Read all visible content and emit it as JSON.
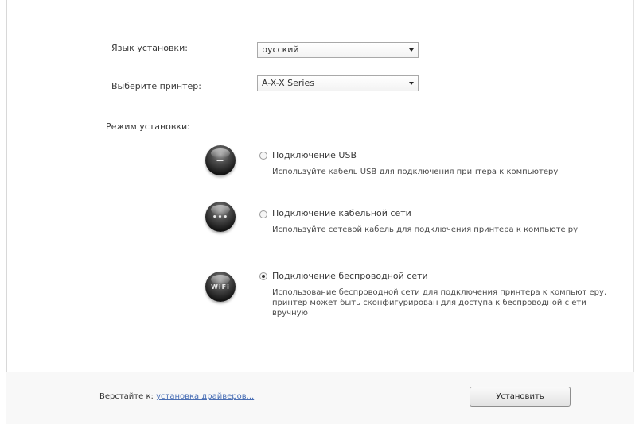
{
  "language": {
    "label": "Язык установки:",
    "value": "русский"
  },
  "printer": {
    "label": "Выберите принтер:",
    "value": "A-X-X Series"
  },
  "mode": {
    "label": "Режим установки:"
  },
  "options": [
    {
      "icon": "usb-icon",
      "glyph": "—",
      "title": "Подключение USB",
      "description": "Используйте кабель USB для подключения принтера к компьютеру",
      "selected": false
    },
    {
      "icon": "wired-network-icon",
      "glyph": "•••",
      "title": "Подключение кабельной сети",
      "description": "Используйте сетевой кабель для подключения принтера к компьюте ру",
      "selected": false
    },
    {
      "icon": "wireless-network-icon",
      "glyph": "WiFi",
      "title": "Подключение беспроводной сети",
      "description": "Использование беспроводной сети для подключения принтера к компьют еру, принтер может быть сконфигурирован для доступа к беспроводной с ети вручную",
      "selected": true
    }
  ],
  "footer": {
    "prefix": "Верстайте к:",
    "link": "установка драйверов..."
  },
  "install_button": "Установить"
}
